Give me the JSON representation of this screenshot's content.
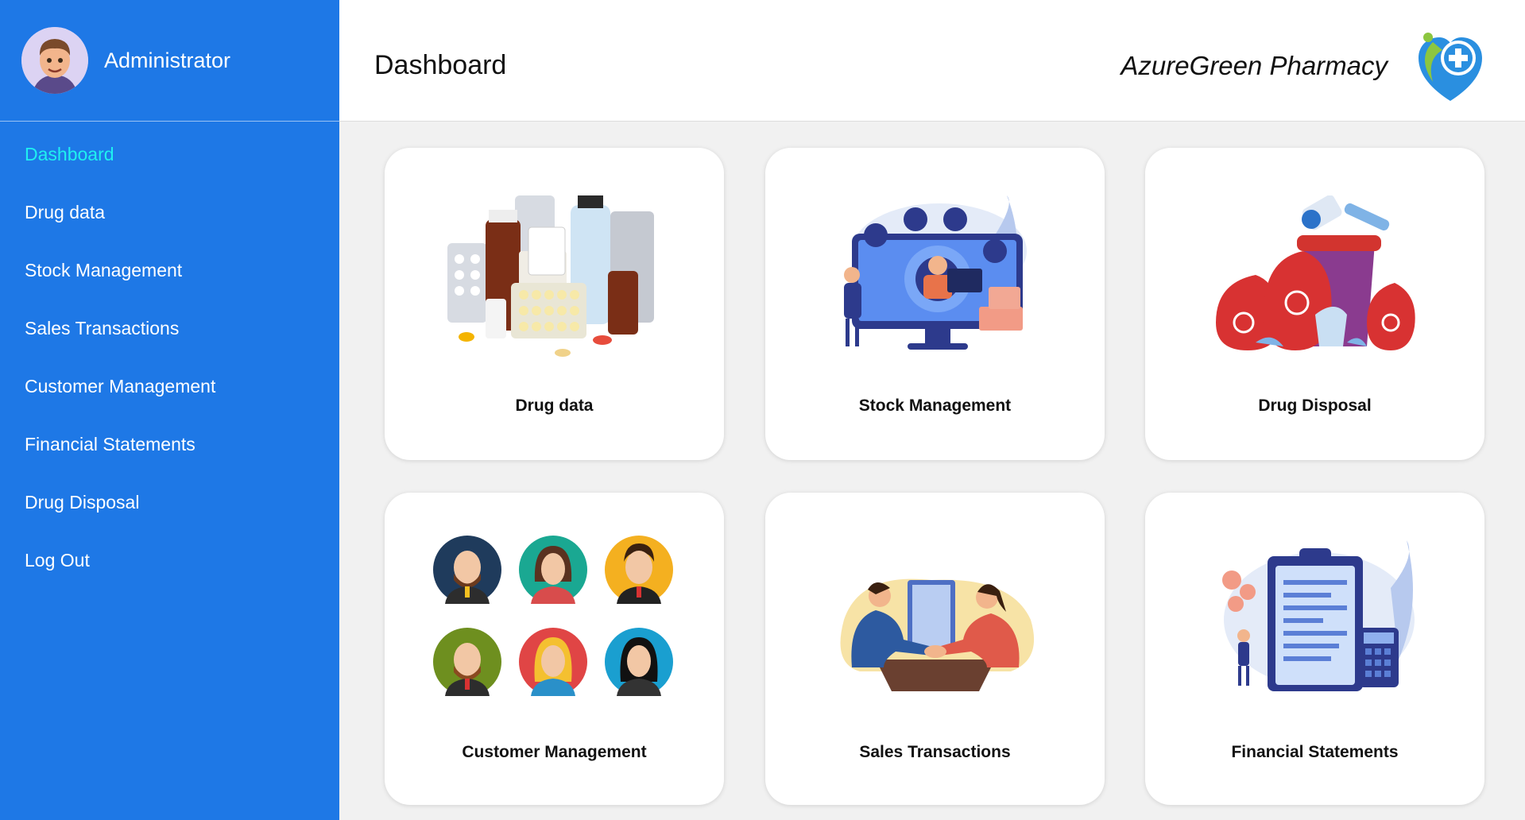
{
  "sidebar": {
    "user_name": "Administrator",
    "nav": [
      {
        "label": "Dashboard",
        "active": true
      },
      {
        "label": "Drug data"
      },
      {
        "label": "Stock Management"
      },
      {
        "label": "Sales Transactions"
      },
      {
        "label": "Customer Management"
      },
      {
        "label": "Financial Statements"
      },
      {
        "label": "Drug Disposal"
      },
      {
        "label": "Log Out"
      }
    ]
  },
  "header": {
    "title": "Dashboard",
    "brand": "AzureGreen Pharmacy"
  },
  "cards": [
    {
      "label": "Drug data",
      "icon": "medicine-bottles-illustration"
    },
    {
      "label": "Stock Management",
      "icon": "stock-monitor-illustration"
    },
    {
      "label": "Drug Disposal",
      "icon": "biohazard-waste-illustration"
    },
    {
      "label": "Customer Management",
      "icon": "customer-avatars-illustration"
    },
    {
      "label": "Sales Transactions",
      "icon": "handshake-illustration"
    },
    {
      "label": "Financial Statements",
      "icon": "clipboard-finance-illustration"
    }
  ],
  "colors": {
    "sidebar": "#1e78e6",
    "active_nav": "#1ff0f0",
    "background": "#f1f1f1"
  }
}
